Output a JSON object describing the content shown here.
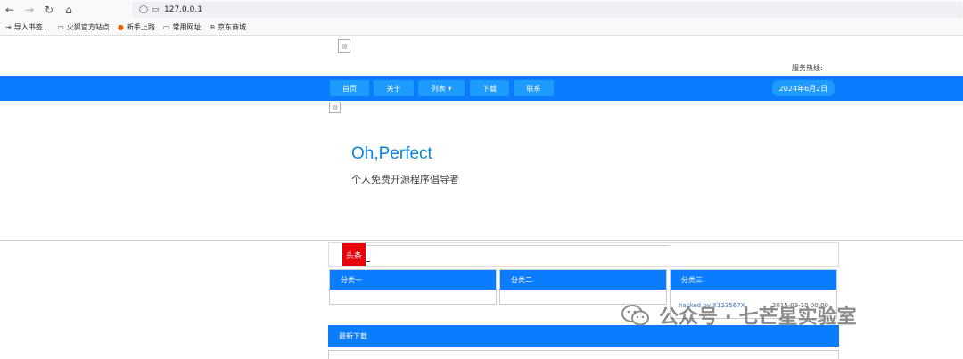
{
  "browser": {
    "url": "127.0.0.1",
    "bookmarks": [
      "导入书签...",
      "火狐官方站点",
      "新手上路",
      "常用网址",
      "京东商城"
    ]
  },
  "header": {
    "hotline_label": "服务热线:"
  },
  "nav": {
    "items": [
      "首页",
      "关于",
      "列表 ▾",
      "下载",
      "联系"
    ],
    "date": "2024年6月2日"
  },
  "hero": {
    "title": "Oh,Perfect",
    "subtitle": "个人免费开源程序倡导者"
  },
  "headline": {
    "tag": "头条"
  },
  "categories": [
    {
      "title": "分类一"
    },
    {
      "title": "分类二"
    },
    {
      "title": "分类三",
      "news_title": "hacked by X123567X",
      "news_date": "2015-03-10 00:00"
    }
  ],
  "downloads": {
    "title": "最新下载"
  },
  "watermark": {
    "text": "公众号 · 七芒星实验室"
  },
  "colors": {
    "nav_bg": "#0a7dff",
    "nav_item": "#1e9bff",
    "hero_title": "#0b86e0",
    "headline_tag": "#e8000b"
  }
}
